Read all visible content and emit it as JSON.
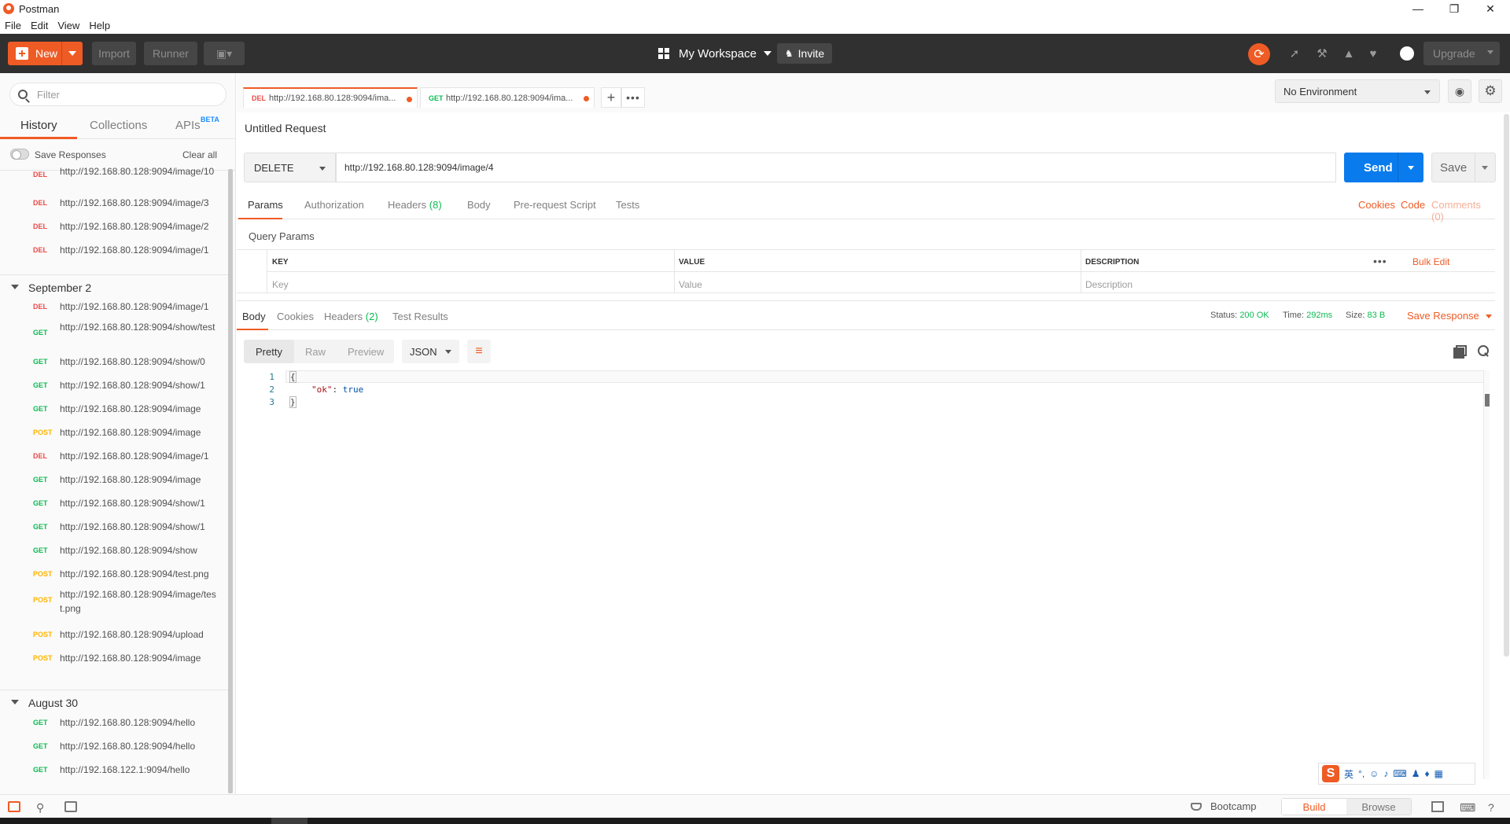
{
  "window": {
    "title": "Postman"
  },
  "menu": [
    "File",
    "Edit",
    "View",
    "Help"
  ],
  "header": {
    "new_label": "New",
    "import_label": "Import",
    "runner_label": "Runner",
    "workspace_label": "My Workspace",
    "invite_label": "Invite",
    "upgrade_label": "Upgrade"
  },
  "sidebar": {
    "filter_placeholder": "Filter",
    "tabs": {
      "history": "History",
      "collections": "Collections",
      "apis": "APIs",
      "beta": "BETA"
    },
    "save_responses": "Save Responses",
    "clear_all": "Clear all",
    "top_items": [
      {
        "method": "DEL",
        "url": "http://192.168.80.128:9094/image/10"
      },
      {
        "method": "DEL",
        "url": "http://192.168.80.128:9094/image/3"
      },
      {
        "method": "DEL",
        "url": "http://192.168.80.128:9094/image/2"
      },
      {
        "method": "DEL",
        "url": "http://192.168.80.128:9094/image/1"
      }
    ],
    "group_sep2": {
      "label": "September 2",
      "items": [
        {
          "method": "DEL",
          "url": "http://192.168.80.128:9094/image/1"
        },
        {
          "method": "GET",
          "url": "http://192.168.80.128:9094/show/test"
        },
        {
          "method": "GET",
          "url": "http://192.168.80.128:9094/show/0"
        },
        {
          "method": "GET",
          "url": "http://192.168.80.128:9094/show/1"
        },
        {
          "method": "GET",
          "url": "http://192.168.80.128:9094/image"
        },
        {
          "method": "POST",
          "url": "http://192.168.80.128:9094/image"
        },
        {
          "method": "DEL",
          "url": "http://192.168.80.128:9094/image/1"
        },
        {
          "method": "GET",
          "url": "http://192.168.80.128:9094/image"
        },
        {
          "method": "GET",
          "url": "http://192.168.80.128:9094/show/1"
        },
        {
          "method": "GET",
          "url": "http://192.168.80.128:9094/show/1"
        },
        {
          "method": "GET",
          "url": "http://192.168.80.128:9094/show"
        },
        {
          "method": "POST",
          "url": "http://192.168.80.128:9094/test.png"
        },
        {
          "method": "POST",
          "url": "http://192.168.80.128:9094/image/test.png"
        },
        {
          "method": "POST",
          "url": "http://192.168.80.128:9094/upload"
        },
        {
          "method": "POST",
          "url": "http://192.168.80.128:9094/image"
        }
      ]
    },
    "group_aug30": {
      "label": "August 30",
      "items": [
        {
          "method": "GET",
          "url": "http://192.168.80.128:9094/hello"
        },
        {
          "method": "GET",
          "url": "http://192.168.80.128:9094/hello"
        },
        {
          "method": "GET",
          "url": "http://192.168.122.1:9094/hello"
        }
      ]
    }
  },
  "request_tabs": [
    {
      "method": "DEL",
      "url": "http://192.168.80.128:9094/ima..."
    },
    {
      "method": "GET",
      "url": "http://192.168.80.128:9094/ima..."
    }
  ],
  "environment": {
    "selected": "No Environment"
  },
  "request": {
    "title": "Untitled Request",
    "method": "DELETE",
    "url": "http://192.168.80.128:9094/image/4",
    "send_label": "Send",
    "save_label": "Save",
    "tabs": {
      "params": "Params",
      "authorization": "Authorization",
      "headers": "Headers",
      "headers_count": "(8)",
      "body": "Body",
      "prerequest": "Pre-request Script",
      "tests": "Tests"
    },
    "links": {
      "cookies": "Cookies",
      "code": "Code",
      "comments": "Comments (0)"
    },
    "query_params": {
      "title": "Query Params",
      "headers": {
        "key": "KEY",
        "value": "VALUE",
        "description": "DESCRIPTION"
      },
      "placeholders": {
        "key": "Key",
        "value": "Value",
        "description": "Description"
      },
      "bulk_edit": "Bulk Edit"
    }
  },
  "response": {
    "tabs": {
      "body": "Body",
      "cookies": "Cookies",
      "headers": "Headers",
      "headers_count": "(2)",
      "test_results": "Test Results"
    },
    "status_label": "Status:",
    "status_value": "200 OK",
    "time_label": "Time:",
    "time_value": "292ms",
    "size_label": "Size:",
    "size_value": "83 B",
    "save_response": "Save Response",
    "format_buttons": {
      "pretty": "Pretty",
      "raw": "Raw",
      "preview": "Preview"
    },
    "format": "JSON",
    "code_lines": [
      {
        "n": "1",
        "text": "{"
      },
      {
        "n": "2",
        "key": "\"ok\"",
        "sep": ": ",
        "val": "true"
      },
      {
        "n": "3",
        "text": "}"
      }
    ]
  },
  "ime": {
    "lang": "英",
    "punct": "°,"
  },
  "footer": {
    "bootcamp": "Bootcamp",
    "build": "Build",
    "browse": "Browse"
  },
  "colors": {
    "accent": "#ef5b25",
    "primary": "#097bed",
    "del": "#ed4b48",
    "get": "#0cbb52",
    "post": "#ffb400"
  }
}
